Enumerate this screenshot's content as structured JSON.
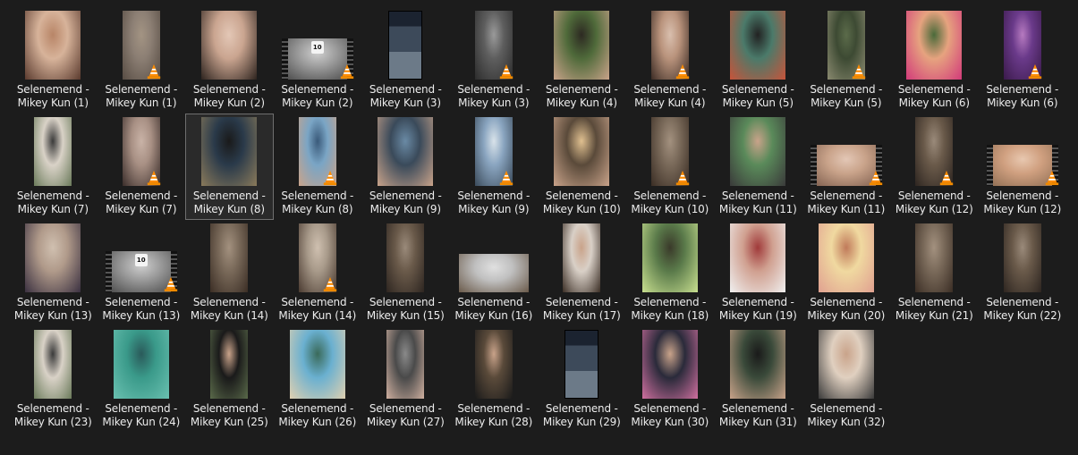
{
  "window": {
    "background": "#1c1c1c",
    "selected_item_index": 14
  },
  "icons": {
    "vlc_overlay": "vlc-cone-icon",
    "film_badge": "film-strip-icon"
  },
  "items": [
    {
      "line1": "Selenemend -",
      "line2": "Mikey Kun (1)",
      "kind": "photo",
      "shape": "portrait",
      "colors": [
        "#d7b39a",
        "#5a3a2e",
        "#b88567"
      ]
    },
    {
      "line1": "Selenemend -",
      "line2": "Mikey Kun (1)",
      "kind": "video",
      "shape": "narrow",
      "colors": [
        "#8c7f74",
        "#574c43",
        "#a39483"
      ]
    },
    {
      "line1": "Selenemend -",
      "line2": "Mikey Kun (2)",
      "kind": "photo",
      "shape": "portrait",
      "colors": [
        "#caa590",
        "#2d231e",
        "#e3c7b6"
      ]
    },
    {
      "line1": "Selenemend -",
      "line2": "Mikey Kun (2)",
      "kind": "video",
      "shape": "wide-film",
      "badge": "10",
      "colors": [
        "#9b9b9b",
        "#444444",
        "#cfcfcf"
      ]
    },
    {
      "line1": "Selenemend -",
      "line2": "Mikey Kun (3)",
      "kind": "photo",
      "shape": "phone",
      "colors": [
        "#1b2330",
        "#3d4a5a",
        "#6c7a88"
      ]
    },
    {
      "line1": "Selenemend -",
      "line2": "Mikey Kun (3)",
      "kind": "video",
      "shape": "narrow",
      "colors": [
        "#5e5e5e",
        "#2c2c2c",
        "#9a9a9a"
      ]
    },
    {
      "line1": "Selenemend -",
      "line2": "Mikey Kun (4)",
      "kind": "photo",
      "shape": "portrait",
      "colors": [
        "#4f6a3a",
        "#c9a38a",
        "#2d2a22"
      ]
    },
    {
      "line1": "Selenemend -",
      "line2": "Mikey Kun (4)",
      "kind": "video",
      "shape": "narrow",
      "colors": [
        "#b9937c",
        "#3b2b24",
        "#d9bfae"
      ]
    },
    {
      "line1": "Selenemend -",
      "line2": "Mikey Kun (5)",
      "kind": "photo",
      "shape": "portrait",
      "colors": [
        "#4b7a6a",
        "#c8543a",
        "#222222"
      ]
    },
    {
      "line1": "Selenemend -",
      "line2": "Mikey Kun (5)",
      "kind": "video",
      "shape": "narrow",
      "colors": [
        "#3d4a33",
        "#8a8a70",
        "#5b6b4a"
      ]
    },
    {
      "line1": "Selenemend -",
      "line2": "Mikey Kun (6)",
      "kind": "photo",
      "shape": "portrait",
      "colors": [
        "#e6a37f",
        "#d23a7a",
        "#4a6a3a"
      ]
    },
    {
      "line1": "Selenemend -",
      "line2": "Mikey Kun (6)",
      "kind": "video",
      "shape": "narrow",
      "colors": [
        "#6a3a8a",
        "#3a1a4a",
        "#b67ac0"
      ]
    },
    {
      "line1": "Selenemend -",
      "line2": "Mikey Kun (7)",
      "kind": "photo",
      "shape": "narrow",
      "colors": [
        "#d9d2c7",
        "#6a7a5a",
        "#3a3a3a"
      ]
    },
    {
      "line1": "Selenemend -",
      "line2": "Mikey Kun (7)",
      "kind": "video",
      "shape": "narrow",
      "colors": [
        "#a89084",
        "#3a2d2a",
        "#c9b3a7"
      ]
    },
    {
      "line1": "Selenemend -",
      "line2": "Mikey Kun (8)",
      "kind": "photo",
      "shape": "portrait",
      "colors": [
        "#2a3a4a",
        "#8a7a5a",
        "#1a1a1a"
      ]
    },
    {
      "line1": "Selenemend -",
      "line2": "Mikey Kun (8)",
      "kind": "video",
      "shape": "narrow",
      "colors": [
        "#7aa5c5",
        "#c9a38a",
        "#3a5a7a"
      ]
    },
    {
      "line1": "Selenemend -",
      "line2": "Mikey Kun (9)",
      "kind": "photo",
      "shape": "portrait",
      "colors": [
        "#3a4a5a",
        "#c9a38a",
        "#6a8aa5"
      ]
    },
    {
      "line1": "Selenemend -",
      "line2": "Mikey Kun (9)",
      "kind": "video",
      "shape": "narrow",
      "colors": [
        "#8aa5c0",
        "#3a4a5a",
        "#d9e3ea"
      ]
    },
    {
      "line1": "Selenemend -",
      "line2": "Mikey Kun (10)",
      "kind": "photo",
      "shape": "portrait",
      "colors": [
        "#5a4a3a",
        "#c9a38a",
        "#e0c090"
      ]
    },
    {
      "line1": "Selenemend -",
      "line2": "Mikey Kun (10)",
      "kind": "video",
      "shape": "narrow",
      "colors": [
        "#7a6a5a",
        "#3a2d24",
        "#a3917f"
      ]
    },
    {
      "line1": "Selenemend -",
      "line2": "Mikey Kun (11)",
      "kind": "photo",
      "shape": "portrait",
      "colors": [
        "#5a8a5a",
        "#3a3a3a",
        "#c9a38a"
      ]
    },
    {
      "line1": "Selenemend -",
      "line2": "Mikey Kun (11)",
      "kind": "video",
      "shape": "wide-film",
      "colors": [
        "#c9a38a",
        "#7a5a4a",
        "#e3c7b6"
      ]
    },
    {
      "line1": "Selenemend -",
      "line2": "Mikey Kun (12)",
      "kind": "video",
      "shape": "narrow",
      "colors": [
        "#6a5a4a",
        "#2d2520",
        "#9a8a7a"
      ]
    },
    {
      "line1": "Selenemend -",
      "line2": "Mikey Kun (12)",
      "kind": "video",
      "shape": "wide-film",
      "colors": [
        "#d0a080",
        "#8a6a50",
        "#e8c8b0"
      ]
    },
    {
      "line1": "Selenemend -",
      "line2": "Mikey Kun (13)",
      "kind": "photo",
      "shape": "portrait",
      "colors": [
        "#b09a8a",
        "#3a3040",
        "#d0c0b0"
      ]
    },
    {
      "line1": "Selenemend -",
      "line2": "Mikey Kun (13)",
      "kind": "video",
      "shape": "wide-film",
      "badge": "10",
      "colors": [
        "#9b9b9b",
        "#444444",
        "#cfcfcf"
      ]
    },
    {
      "line1": "Selenemend -",
      "line2": "Mikey Kun (14)",
      "kind": "photo",
      "shape": "narrow",
      "colors": [
        "#7a6a5a",
        "#3a2d24",
        "#a3917f"
      ]
    },
    {
      "line1": "Selenemend -",
      "line2": "Mikey Kun (14)",
      "kind": "video",
      "shape": "narrow",
      "colors": [
        "#a89a8a",
        "#4a3a30",
        "#cfc0b0"
      ]
    },
    {
      "line1": "Selenemend -",
      "line2": "Mikey Kun (15)",
      "kind": "photo",
      "shape": "narrow",
      "colors": [
        "#6a5a4a",
        "#2d2520",
        "#9a8a7a"
      ]
    },
    {
      "line1": "Selenemend -",
      "line2": "Mikey Kun (16)",
      "kind": "photo",
      "shape": "land",
      "colors": [
        "#c0c0c0",
        "#6a5a4a",
        "#e0e0e0"
      ]
    },
    {
      "line1": "Selenemend -",
      "line2": "Mikey Kun (17)",
      "kind": "photo",
      "shape": "narrow",
      "colors": [
        "#d9d0c7",
        "#3a2d24",
        "#c9a38a"
      ]
    },
    {
      "line1": "Selenemend -",
      "line2": "Mikey Kun (18)",
      "kind": "photo",
      "shape": "portrait",
      "colors": [
        "#5a7a4a",
        "#c9e090",
        "#3a3a2a"
      ]
    },
    {
      "line1": "Selenemend -",
      "line2": "Mikey Kun (19)",
      "kind": "photo",
      "shape": "portrait",
      "colors": [
        "#d0a090",
        "#f0f0f0",
        "#a03a3a"
      ]
    },
    {
      "line1": "Selenemend -",
      "line2": "Mikey Kun (20)",
      "kind": "photo",
      "shape": "portrait",
      "colors": [
        "#f0d9a0",
        "#e0a090",
        "#c07a5a"
      ]
    },
    {
      "line1": "Selenemend -",
      "line2": "Mikey Kun (21)",
      "kind": "photo",
      "shape": "narrow",
      "colors": [
        "#7a6a5a",
        "#3a2d24",
        "#a3917f"
      ]
    },
    {
      "line1": "Selenemend -",
      "line2": "Mikey Kun (22)",
      "kind": "photo",
      "shape": "narrow",
      "colors": [
        "#6a5a4a",
        "#2d2520",
        "#9a8a7a"
      ]
    },
    {
      "line1": "Selenemend -",
      "line2": "Mikey Kun (23)",
      "kind": "photo",
      "shape": "narrow",
      "colors": [
        "#d9d2c7",
        "#6a7a5a",
        "#3a3a3a"
      ]
    },
    {
      "line1": "Selenemend -",
      "line2": "Mikey Kun (24)",
      "kind": "photo",
      "shape": "portrait",
      "colors": [
        "#3a9a8a",
        "#6ac0b0",
        "#2a5a5a"
      ]
    },
    {
      "line1": "Selenemend -",
      "line2": "Mikey Kun (25)",
      "kind": "photo",
      "shape": "narrow",
      "colors": [
        "#1a1a1a",
        "#5a6a4a",
        "#c9a38a"
      ]
    },
    {
      "line1": "Selenemend -",
      "line2": "Mikey Kun (26)",
      "kind": "photo",
      "shape": "portrait",
      "colors": [
        "#6ab0d0",
        "#e0d0b0",
        "#3a6a5a"
      ]
    },
    {
      "line1": "Selenemend -",
      "line2": "Mikey Kun (27)",
      "kind": "photo",
      "shape": "narrow",
      "colors": [
        "#4a4a4a",
        "#d0b0a0",
        "#8a8a8a"
      ]
    },
    {
      "line1": "Selenemend -",
      "line2": "Mikey Kun (28)",
      "kind": "photo",
      "shape": "narrow",
      "colors": [
        "#5a4a3a",
        "#1a1a1a",
        "#c9a38a"
      ]
    },
    {
      "line1": "Selenemend -",
      "line2": "Mikey Kun (29)",
      "kind": "photo",
      "shape": "phone",
      "colors": [
        "#1b2330",
        "#3d4a5a",
        "#6c7a88"
      ]
    },
    {
      "line1": "Selenemend -",
      "line2": "Mikey Kun (30)",
      "kind": "photo",
      "shape": "portrait",
      "colors": [
        "#2a2a3a",
        "#d070a0",
        "#c9a38a"
      ]
    },
    {
      "line1": "Selenemend -",
      "line2": "Mikey Kun (31)",
      "kind": "photo",
      "shape": "portrait",
      "colors": [
        "#3a4a3a",
        "#c9a38a",
        "#1a1a1a"
      ]
    },
    {
      "line1": "Selenemend -",
      "line2": "Mikey Kun (32)",
      "kind": "photo",
      "shape": "portrait",
      "colors": [
        "#e0d0c0",
        "#3a3a3a",
        "#c9a38a"
      ]
    }
  ]
}
